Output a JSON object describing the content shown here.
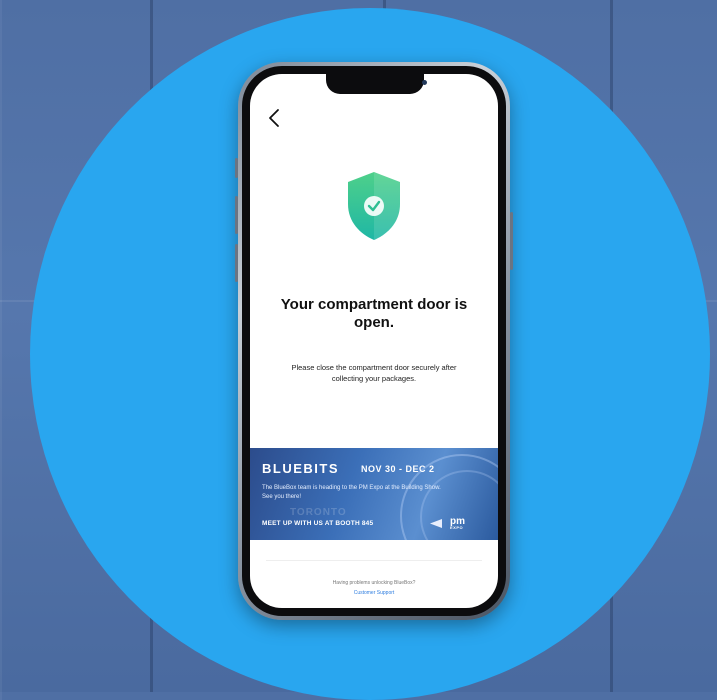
{
  "screen": {
    "title": "Your compartment door is open.",
    "message": "Please close the compartment door securely after collecting your packages.",
    "help_text": "Having problems unlocking BlueBox?",
    "support_link": "Customer Support"
  },
  "banner": {
    "brand": "BLUEBITS",
    "dates": "NOV 30 - DEC 2",
    "description": "The BlueBox team is heading to the PM Expo at the Building Show. See you there!",
    "city_text": "TORONTO",
    "cta": "MEET UP WITH US AT BOOTH 845",
    "logo": "pm",
    "logo_sub": "EXPO"
  },
  "icons": {
    "back": "chevron-left-icon",
    "status": "shield-check-icon"
  },
  "colors": {
    "circle": "#29a6ef",
    "shield_top": "#4ed08a",
    "shield_bottom": "#1fb7a5",
    "link": "#2f7ee0"
  }
}
